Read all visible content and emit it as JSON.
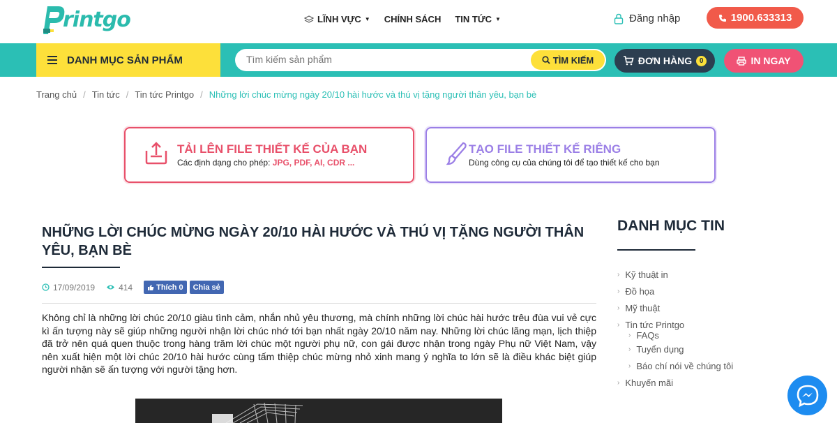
{
  "brand": {
    "logo_text": "rintgo"
  },
  "topnav": {
    "items": [
      {
        "label": "LĨNH VỰC"
      },
      {
        "label": "CHÍNH SÁCH"
      },
      {
        "label": "TIN TỨC"
      }
    ],
    "login_label": "Đăng nhập",
    "hotline": "1900.633313"
  },
  "mainbar": {
    "category_label": "DANH MỤC SẢN PHẨM",
    "search_placeholder": "Tìm kiếm sản phẩm",
    "search_button": "TÌM KIẾM",
    "orders_label": "ĐƠN HÀNG",
    "orders_count": "0",
    "print_now": "IN NGAY"
  },
  "breadcrumb": {
    "items": [
      "Trang chủ",
      "Tin tức",
      "Tin tức Printgo"
    ],
    "current": "Những lời chúc mừng ngày 20/10 hài hước và thú vị tặng người thân yêu, bạn bè"
  },
  "cta": {
    "upload": {
      "title": "TẢI LÊN FILE THIẾT KẾ CỦA BẠN",
      "sub_prefix": "Các định dạng cho phép: ",
      "sub_formats": "JPG, PDF, AI, CDR ..."
    },
    "create": {
      "title": "TẠO FILE THIẾT KẾ RIÊNG",
      "sub": "Dùng công cụ của chúng tôi để tạo thiết kế cho bạn"
    }
  },
  "article": {
    "title": "NHỮNG LỜI CHÚC MỪNG NGÀY 20/10 HÀI HƯỚC VÀ THÚ VỊ TẶNG NGƯỜI THÂN YÊU, BẠN BÈ",
    "date": "17/09/2019",
    "views": "414",
    "like_label": "Thích 0",
    "share_label": "Chia sẻ",
    "body": "Không chỉ là những lời chúc 20/10 giàu tình cảm, nhắn nhủ yêu thương, mà chính những lời chúc hài hước trêu đùa vui vẻ cực kì ấn tượng này sẽ giúp những người nhận lời chúc nhớ tới bạn nhất ngày 20/10 năm nay. Những lời chúc lãng mạn, lịch thiệp đã trở nên quá quen thuộc trong hàng trăm lời chúc một người phụ nữ, con gái được nhận trong ngày Phụ nữ Việt Nam, vậy nên xuất hiện một lời chúc 20/10 hài hước cùng tấm thiệp chúc mừng nhỏ xinh mang ý nghĩa to lớn sẽ là điều khác biệt giúp người nhận sẽ ấn tượng với người tặng hơn."
  },
  "sidebar": {
    "title": "DANH MỤC TIN",
    "items": [
      {
        "label": "Kỹ thuật in"
      },
      {
        "label": "Đồ họa"
      },
      {
        "label": "Mỹ thuật"
      },
      {
        "label": "Tin tức Printgo"
      },
      {
        "label": "FAQs"
      },
      {
        "label": "Tuyển dụng"
      },
      {
        "label": "Báo chí nói về chúng tôi"
      },
      {
        "label": "Khuyến mãi"
      }
    ]
  },
  "colors": {
    "teal": "#2bbfb5",
    "yellow": "#fde03a",
    "navy": "#2c3e50",
    "pink": "#f05275",
    "hotline_red": "#f15a4a",
    "purple": "#9b7fe6"
  }
}
